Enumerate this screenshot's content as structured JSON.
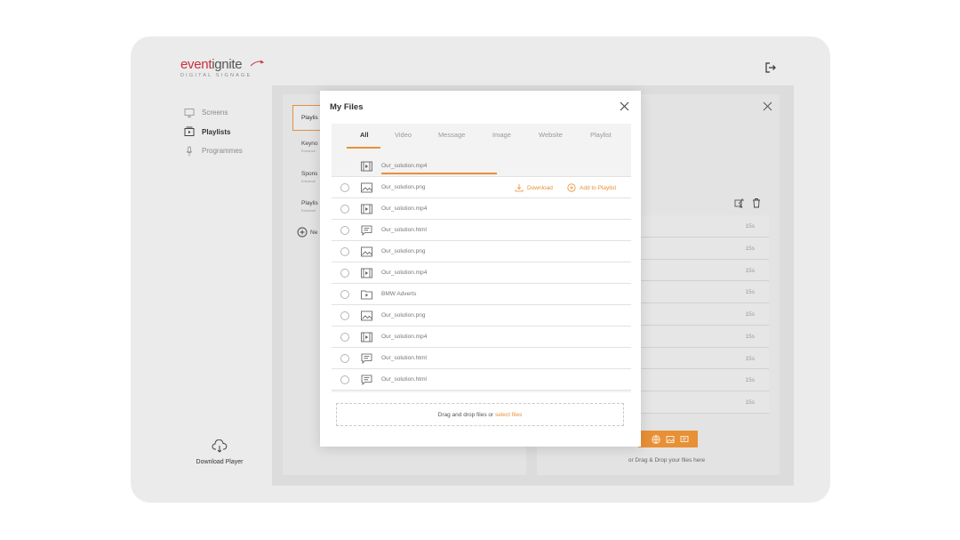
{
  "app": {
    "logo_primary": "event",
    "logo_secondary": "ignite",
    "logo_tagline": "DIGITAL SIGNAGE"
  },
  "sidebar": {
    "items": [
      {
        "label": "Screens",
        "icon": "monitor-icon"
      },
      {
        "label": "Playlists",
        "icon": "playlist-icon"
      },
      {
        "label": "Programmes",
        "icon": "microphone-icon"
      }
    ],
    "download_player": "Download Player"
  },
  "playlists": {
    "tab_label": "Playlis",
    "items": [
      {
        "name": "Keyno",
        "sub": "Entrance"
      },
      {
        "name": "Spons",
        "sub": "Entrance"
      },
      {
        "name": "Playlis",
        "sub": "Entrance"
      }
    ],
    "new_label": "Ne"
  },
  "right_panel": {
    "durations": [
      "15s",
      "15s",
      "15s",
      "15s",
      "15s",
      "15s",
      "15s",
      "15s",
      "15s"
    ],
    "drag_text": "or Drag & Drop your files here"
  },
  "modal": {
    "title": "My Files",
    "tabs": [
      "All",
      "Video",
      "Message",
      "Image",
      "Website",
      "Playlist"
    ],
    "active_tab": "All",
    "uploading": {
      "name": "Our_solution.mp4",
      "icon": "video-file-icon",
      "progress": 0.5
    },
    "files": [
      {
        "name": "Our_solution.png",
        "icon": "image-file-icon"
      },
      {
        "name": "Our_solution.mp4",
        "icon": "video-file-icon"
      },
      {
        "name": "Our_solution.html",
        "icon": "message-file-icon"
      },
      {
        "name": "Our_solution.png",
        "icon": "image-file-icon"
      },
      {
        "name": "Our_solution.mp4",
        "icon": "video-file-icon"
      },
      {
        "name": "BMW Adverts",
        "icon": "playlist-folder-icon"
      },
      {
        "name": "Our_solution.png",
        "icon": "image-file-icon"
      },
      {
        "name": "Our_solution.mp4",
        "icon": "video-file-icon"
      },
      {
        "name": "Our_solution.html",
        "icon": "message-file-icon"
      },
      {
        "name": "Our_solution.html",
        "icon": "message-file-icon"
      }
    ],
    "row_actions": {
      "download": "Download",
      "add_to_playlist": "Add to Playlist"
    },
    "dropzone": {
      "text": "Drag and drop files or ",
      "link": "select files"
    }
  },
  "colors": {
    "accent": "#e89036",
    "brand_red": "#c8313a"
  }
}
